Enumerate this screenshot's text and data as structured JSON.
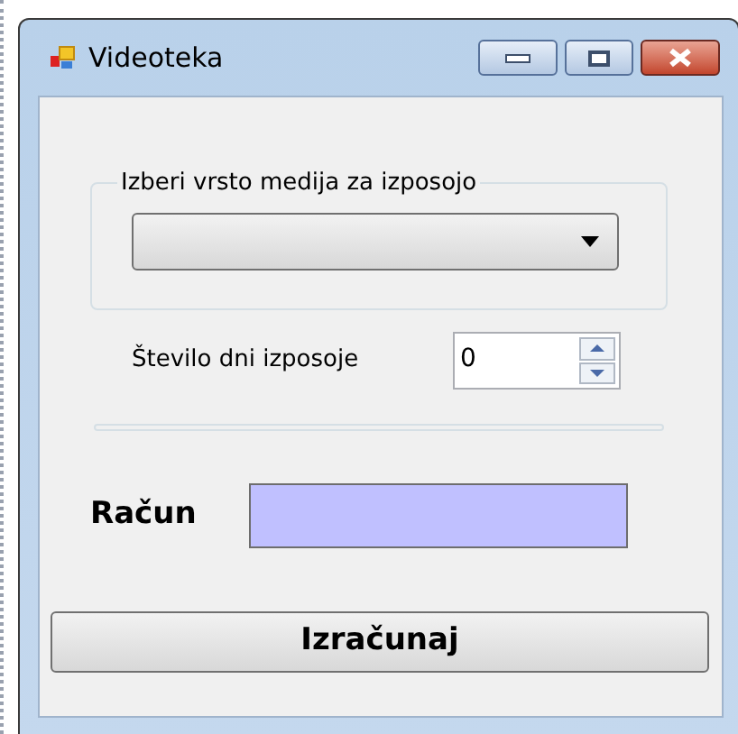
{
  "window": {
    "title": "Videoteka"
  },
  "group": {
    "title": "Izberi vrsto medija za izposojo"
  },
  "days": {
    "label": "Število dni izposoje",
    "value": "0"
  },
  "bill": {
    "label": "Račun"
  },
  "buttons": [
    "Izračunaj"
  ]
}
